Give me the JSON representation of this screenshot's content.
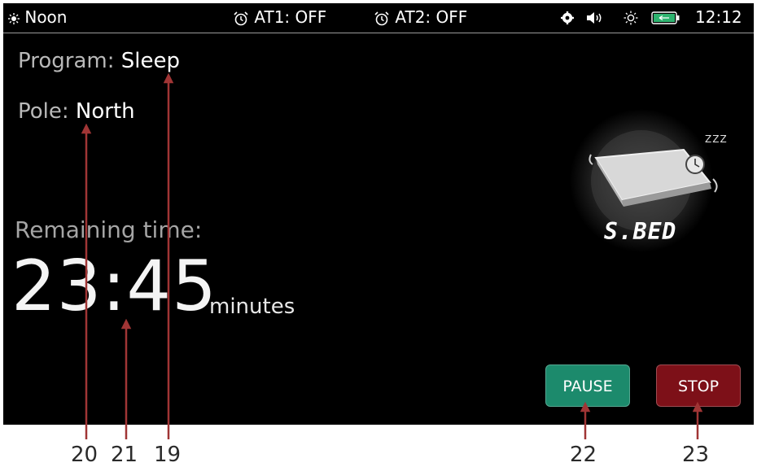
{
  "status_bar": {
    "mode_label": "Noon",
    "alarm1": "AT1: OFF",
    "alarm2": "AT2: OFF",
    "clock": "12:12"
  },
  "program": {
    "label": "Program:",
    "value": "Sleep"
  },
  "pole": {
    "label": "Pole:",
    "value": "North"
  },
  "remaining": {
    "label": "Remaining time:",
    "value": "23:45",
    "unit": "minutes"
  },
  "buttons": {
    "pause": "PAUSE",
    "stop": "STOP"
  },
  "logo": {
    "text": "S.BED",
    "sleep_letters": "ZZZ"
  },
  "annotations": [
    "19",
    "20",
    "21",
    "22",
    "23"
  ],
  "colors": {
    "pause_button": "#1c8a6c",
    "stop_button": "#7d1018",
    "annotation_arrow": "#a03535",
    "battery": "#2eb36f"
  },
  "icons": [
    "sun-icon",
    "alarm-clock-icon",
    "settings-gear-icon",
    "speaker-icon",
    "brightness-icon",
    "battery-icon"
  ]
}
